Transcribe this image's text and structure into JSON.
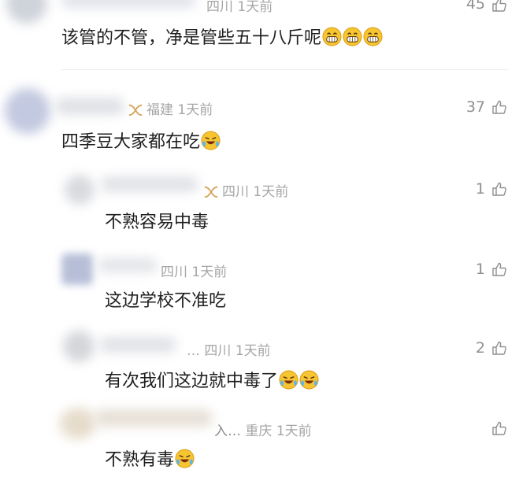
{
  "comments": [
    {
      "location": "四川",
      "time": "1天前",
      "likes": "45",
      "text": "该管的不管，净是管些五十八斤呢",
      "emojis": [
        "grin-emoji",
        "grin-emoji",
        "grin-emoji"
      ]
    },
    {
      "location": "福建",
      "time": "1天前",
      "likes": "37",
      "text": "四季豆大家都在吃",
      "emojis": [
        "laugh-cry-emoji"
      ]
    }
  ],
  "replies": [
    {
      "location": "四川",
      "time": "1天前",
      "likes": "1",
      "text": "不熟容易中毒",
      "emojis": []
    },
    {
      "location": "四川",
      "time": "1天前",
      "likes": "1",
      "text": "这边学校不准吃",
      "emojis": []
    },
    {
      "name_suffix": "…",
      "location": "四川",
      "time": "1天前",
      "likes": "2",
      "text": "有次我们这边就中毒了",
      "emojis": [
        "laugh-cry-emoji",
        "laugh-cry-emoji"
      ]
    },
    {
      "name_suffix": "入…",
      "location": "重庆",
      "time": "1天前",
      "likes": "",
      "text": "不熟有毒",
      "emojis": [
        "laugh-cry-emoji"
      ]
    }
  ],
  "colors": {
    "text": "#1f1f1f",
    "meta": "#a6a6a6",
    "vip_badge": "#d6a35a",
    "emoji": "#f5c518"
  }
}
